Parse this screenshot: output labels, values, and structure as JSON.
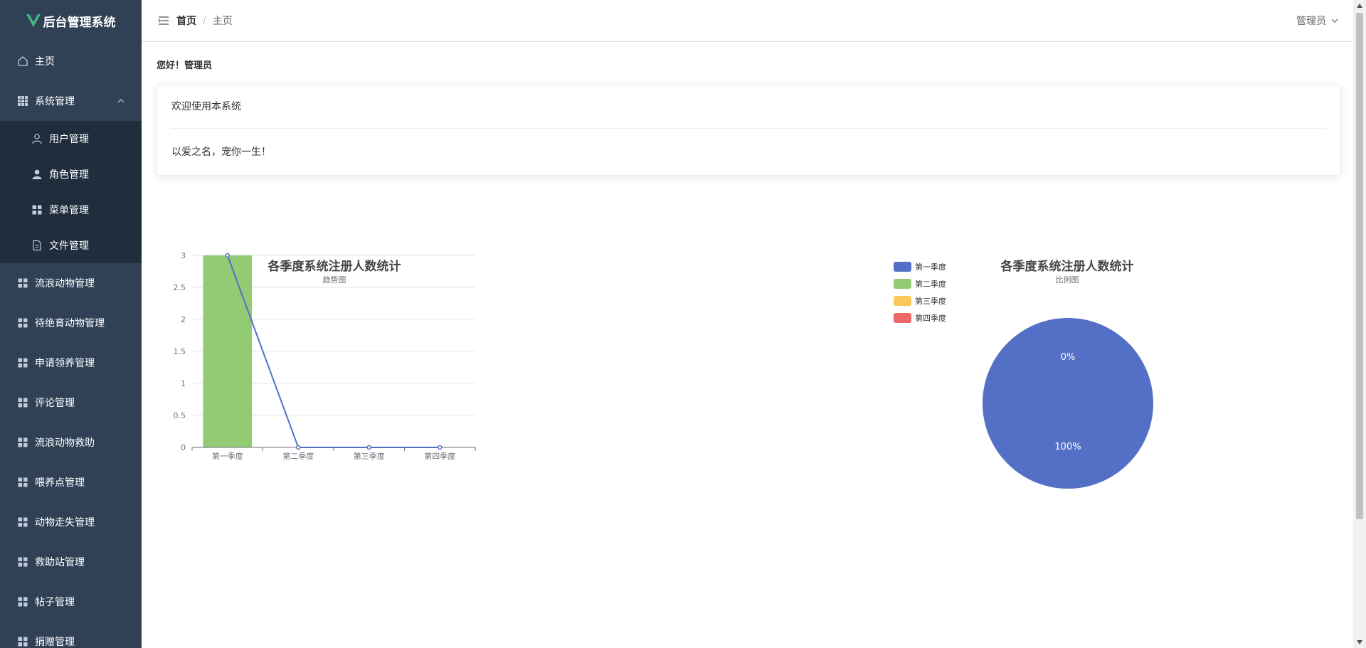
{
  "app": {
    "title": "后台管理系统",
    "brand_color": "#42b983"
  },
  "sidebar": {
    "background": "#304156",
    "items": [
      {
        "label": "主页",
        "icon": "home-icon"
      },
      {
        "label": "系统管理",
        "icon": "grid-icon",
        "expanded": true,
        "children": [
          {
            "label": "用户管理",
            "icon": "user-icon"
          },
          {
            "label": "角色管理",
            "icon": "person-filled-icon"
          },
          {
            "label": "菜单管理",
            "icon": "menu-grid-icon"
          },
          {
            "label": "文件管理",
            "icon": "document-icon"
          }
        ]
      },
      {
        "label": "流浪动物管理",
        "icon": "grid-icon"
      },
      {
        "label": "待绝育动物管理",
        "icon": "grid-icon"
      },
      {
        "label": "申请领养管理",
        "icon": "grid-icon"
      },
      {
        "label": "评论管理",
        "icon": "grid-icon"
      },
      {
        "label": "流浪动物救助",
        "icon": "grid-icon"
      },
      {
        "label": "喂养点管理",
        "icon": "grid-icon"
      },
      {
        "label": "动物走失管理",
        "icon": "grid-icon"
      },
      {
        "label": "救助站管理",
        "icon": "grid-icon"
      },
      {
        "label": "帖子管理",
        "icon": "grid-icon"
      },
      {
        "label": "捐赠管理",
        "icon": "grid-icon"
      }
    ]
  },
  "header": {
    "breadcrumb": [
      "首页",
      "主页"
    ],
    "breadcrumb_sep": "/",
    "user": "管理员"
  },
  "main": {
    "greeting": "您好！管理员",
    "card": {
      "title": "欢迎使用本系统",
      "body": "以爱之名，宠你一生！"
    }
  },
  "chart_data": [
    {
      "type": "bar",
      "title": "各季度系统注册人数统计",
      "subtitle": "趋势图",
      "categories": [
        "第一季度",
        "第二季度",
        "第三季度",
        "第四季度"
      ],
      "series": [
        {
          "type": "bar",
          "values": [
            3,
            0,
            0,
            0
          ],
          "color": "#91cc75"
        },
        {
          "type": "line",
          "values": [
            3,
            0,
            0,
            0
          ],
          "color": "#5470c6"
        }
      ],
      "yticks": [
        "0",
        "0.5",
        "1",
        "1.5",
        "2",
        "2.5",
        "3"
      ],
      "ylim": [
        0,
        3
      ],
      "grid": true
    },
    {
      "type": "pie",
      "title": "各季度系统注册人数统计",
      "subtitle": "比例图",
      "legend_position": "left",
      "slices": [
        {
          "name": "第一季度",
          "value": 100,
          "color": "#5470c6"
        },
        {
          "name": "第二季度",
          "value": 0,
          "color": "#91cc75"
        },
        {
          "name": "第三季度",
          "value": 0,
          "color": "#fac858"
        },
        {
          "name": "第四季度",
          "value": 0,
          "color": "#ee6666"
        }
      ],
      "labels": [
        "0%",
        "100%"
      ]
    }
  ]
}
